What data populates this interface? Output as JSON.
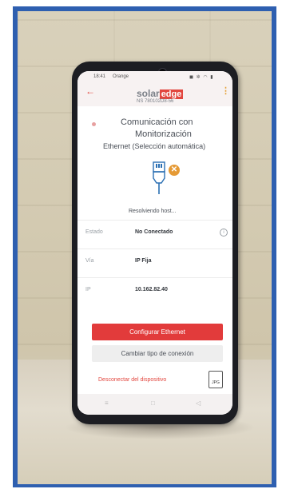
{
  "status_bar": {
    "time": "18:41",
    "carrier": "Orange",
    "icons": "◼ ✲ ◠ ▮"
  },
  "header": {
    "back_icon": "←",
    "logo_solar": "solar",
    "logo_edge": "edge",
    "serial": "NS 780102D8-56",
    "menu_icon": "⋮"
  },
  "page": {
    "title_line1": "Comunicación con",
    "title_line2": "Monitorización",
    "subtitle": "Ethernet (Selección automática)",
    "resolving_text": "Resolviendo host...",
    "error_badge": "✕"
  },
  "details": [
    {
      "label": "Estado",
      "value": "No Conectado"
    },
    {
      "label": "Vía",
      "value": "IP Fija"
    },
    {
      "label": "IP",
      "value": "10.162.82.40"
    }
  ],
  "info_icon": "i",
  "buttons": {
    "configure": "Configurar Ethernet",
    "change_type": "Cambiar tipo de conexión",
    "disconnect": "Desconectar del dispositivo",
    "jpg": "JPG"
  },
  "navbar": {
    "menu": "≡",
    "home": "□",
    "back": "◁"
  },
  "colors": {
    "frame": "#2e5fb0",
    "accent_red": "#e23b3b",
    "badge_orange": "#e59a35"
  }
}
